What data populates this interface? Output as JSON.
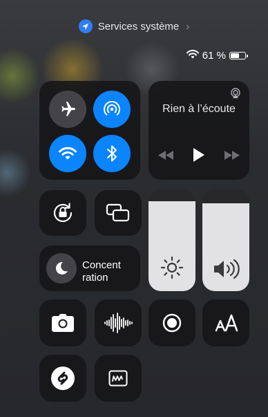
{
  "banner": {
    "text": "Services système",
    "chevron": "›",
    "icon": "location-arrow-icon"
  },
  "status": {
    "battery_text": "61 %",
    "battery_level": 0.61,
    "wifi_icon": "wifi-icon"
  },
  "connectivity": [
    {
      "name": "airplane-mode",
      "icon": "airplane-icon",
      "active": false
    },
    {
      "name": "airdrop",
      "icon": "airdrop-icon",
      "active": true
    },
    {
      "name": "wifi",
      "icon": "wifi-icon",
      "active": true
    },
    {
      "name": "bluetooth",
      "icon": "bluetooth-icon",
      "active": true
    }
  ],
  "now_playing": {
    "title": "Rien à l’écoute",
    "airplay_icon": "airplay-icon"
  },
  "focus": {
    "label": "Concent\nration",
    "icon": "moon-icon"
  },
  "sliders": {
    "brightness_level": 0.88,
    "volume_level": 0.86
  },
  "colors": {
    "accent": "#0a84ff",
    "tile": "#161618",
    "slider_fill": "#e2e2e4"
  }
}
